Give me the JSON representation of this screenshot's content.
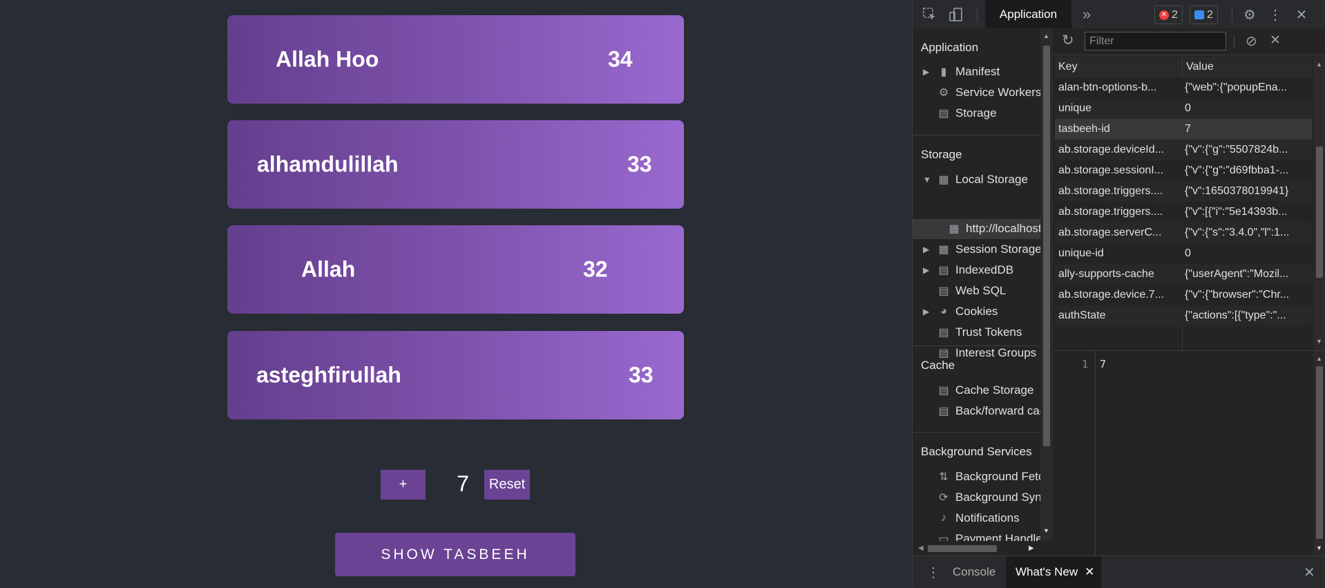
{
  "app": {
    "cards": [
      {
        "name": "Allah Hoo",
        "count": "34"
      },
      {
        "name": "alhamdulillah",
        "count": "33"
      },
      {
        "name": "Allah",
        "count": "32"
      },
      {
        "name": "asteghfirullah",
        "count": "33"
      }
    ],
    "plus_label": "+",
    "counter_value": "7",
    "reset_label": "Reset",
    "show_label": "SHOW TASBEEH"
  },
  "devtools": {
    "active_tab": "Application",
    "more_tabs": "»",
    "error_count": "2",
    "message_count": "2",
    "sidebar": {
      "application_header": "Application",
      "manifest": "Manifest",
      "service_workers": "Service Workers",
      "storage_item": "Storage",
      "storage_header": "Storage",
      "local_storage": "Local Storage",
      "localhost": "http://localhost",
      "session_storage": "Session Storage",
      "indexeddb": "IndexedDB",
      "websql": "Web SQL",
      "cookies": "Cookies",
      "trust_tokens": "Trust Tokens",
      "interest_groups": "Interest Groups",
      "cache_header": "Cache",
      "cache_storage": "Cache Storage",
      "back_forward": "Back/forward cache",
      "bg_header": "Background Services",
      "bg_fetch": "Background Fetch",
      "bg_sync": "Background Sync",
      "notifications": "Notifications",
      "payment": "Payment Handler"
    },
    "filter_placeholder": "Filter",
    "table": {
      "key_header": "Key",
      "value_header": "Value",
      "rows": [
        {
          "key": "alan-btn-options-b...",
          "value": "{\"web\":{\"popupEna..."
        },
        {
          "key": "unique",
          "value": "0"
        },
        {
          "key": "tasbeeh-id",
          "value": "7"
        },
        {
          "key": "ab.storage.deviceId...",
          "value": "{\"v\":{\"g\":\"5507824b..."
        },
        {
          "key": "ab.storage.sessionI...",
          "value": "{\"v\":{\"g\":\"d69fbba1-..."
        },
        {
          "key": "ab.storage.triggers....",
          "value": "{\"v\":1650378019941}"
        },
        {
          "key": "ab.storage.triggers....",
          "value": "{\"v\":[{\"i\":\"5e14393b..."
        },
        {
          "key": "ab.storage.serverC...",
          "value": "{\"v\":{\"s\":\"3.4.0\",\"l\":1..."
        },
        {
          "key": "unique-id",
          "value": "0"
        },
        {
          "key": "ally-supports-cache",
          "value": "{\"userAgent\":\"Mozil..."
        },
        {
          "key": "ab.storage.device.7...",
          "value": "{\"v\":{\"browser\":\"Chr..."
        },
        {
          "key": "authState",
          "value": "{\"actions\":[{\"type\":\"..."
        }
      ]
    },
    "preview": {
      "line_number": "1",
      "value": "7"
    },
    "drawer": {
      "console": "Console",
      "whats_new": "What's New"
    }
  },
  "colors": {
    "card_start": "#643f8e",
    "card_end": "#9a69d0",
    "button": "#6a4394",
    "bg": "#282c34"
  }
}
